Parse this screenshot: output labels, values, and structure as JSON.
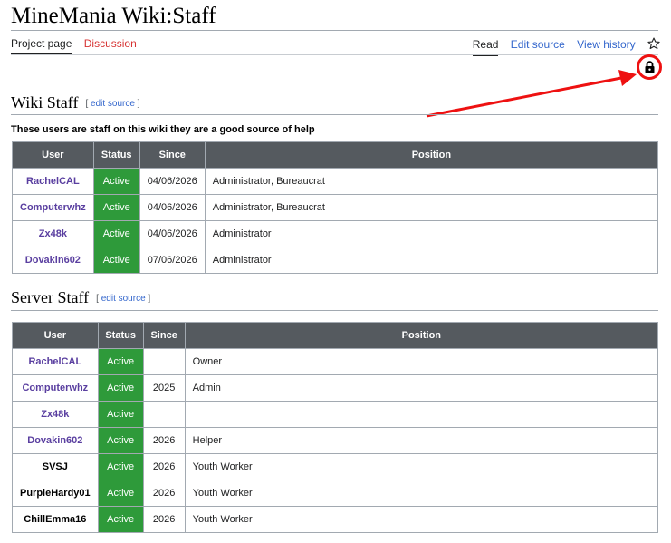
{
  "page": {
    "title": "MineMania Wiki:Staff",
    "tabs_left": [
      "Project page",
      "Discussion"
    ],
    "tabs_right": [
      "Read",
      "Edit source",
      "View history"
    ],
    "star_icon": "star-icon",
    "lock_icon": "lock-icon"
  },
  "wiki_staff": {
    "heading": "Wiki Staff",
    "edit_source": "edit source",
    "intro": "These users are staff on this wiki they are a good source of help",
    "headers": [
      "User",
      "Status",
      "Since",
      "Position"
    ],
    "rows": [
      {
        "user": "RachelCAL",
        "status": "Active",
        "since": "04/06/2026",
        "position": "Administrator, Bureaucrat"
      },
      {
        "user": "Computerwhz",
        "status": "Active",
        "since": "04/06/2026",
        "position": "Administrator, Bureaucrat"
      },
      {
        "user": "Zx48k",
        "status": "Active",
        "since": "04/06/2026",
        "position": "Administrator"
      },
      {
        "user": "Dovakin602",
        "status": "Active",
        "since": "07/06/2026",
        "position": "Administrator"
      }
    ]
  },
  "server_staff": {
    "heading": "Server Staff",
    "edit_source": "edit source",
    "headers": [
      "User",
      "Status",
      "Since",
      "Position"
    ],
    "rows": [
      {
        "user": "RachelCAL",
        "status": "Active",
        "since": "",
        "position": "Owner"
      },
      {
        "user": "Computerwhz",
        "status": "Active",
        "since": "2025",
        "position": "Admin"
      },
      {
        "user": "Zx48k",
        "status": "Active",
        "since": "",
        "position": ""
      },
      {
        "user": "Dovakin602",
        "status": "Active",
        "since": "2026",
        "position": "Helper"
      },
      {
        "user": "SVSJ",
        "status": "Active",
        "since": "2026",
        "position": "Youth Worker"
      },
      {
        "user": "PurpleHardy01",
        "status": "Active",
        "since": "2026",
        "position": "Youth Worker"
      },
      {
        "user": "ChillEmma16",
        "status": "Active",
        "since": "2026",
        "position": "Youth Worker"
      }
    ]
  },
  "colors": {
    "active": "#2e9a3a",
    "header_bg": "#555a5f",
    "link": "#3366cc",
    "user_link": "#5a3fa0",
    "annotation": "#e11"
  }
}
